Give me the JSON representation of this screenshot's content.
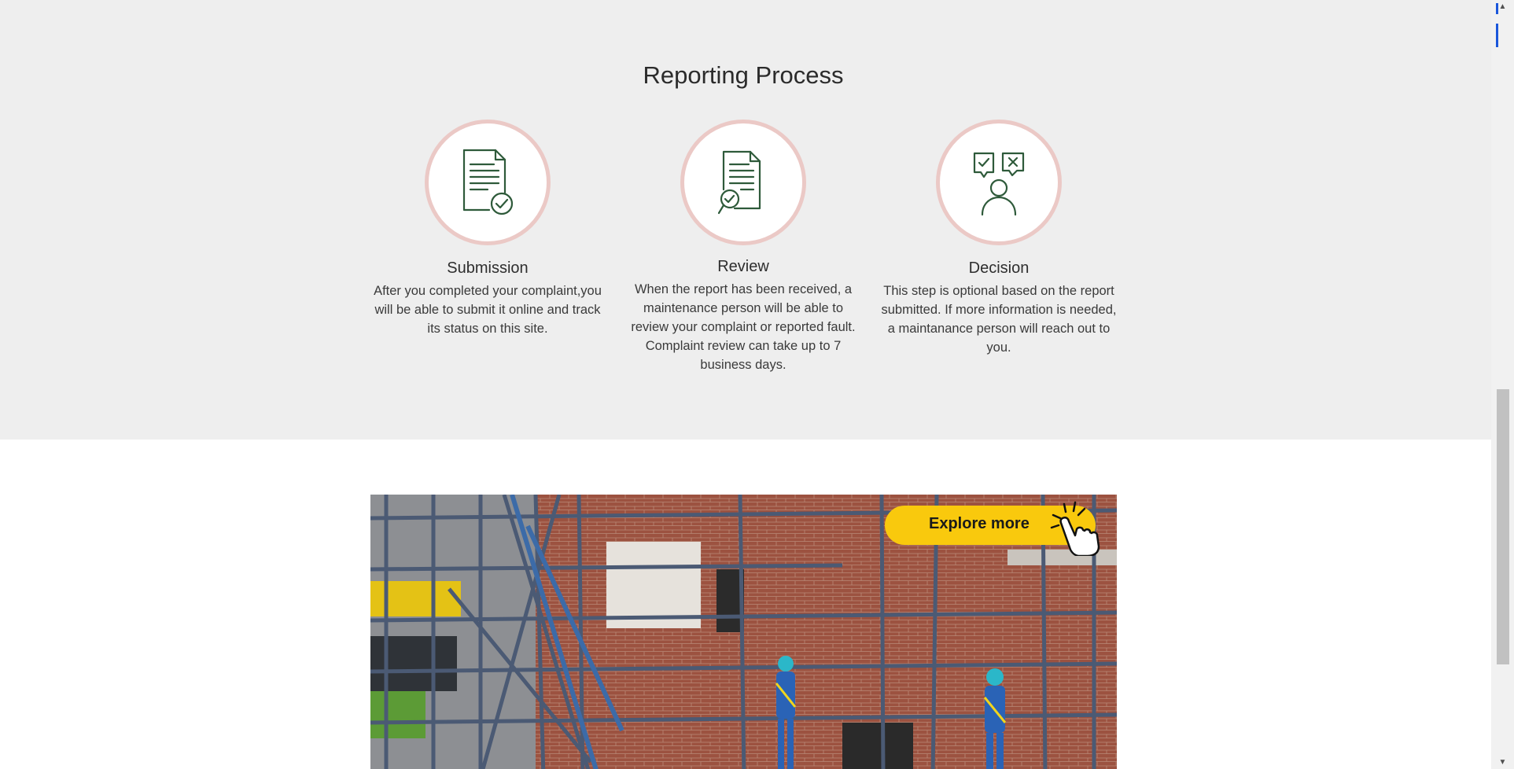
{
  "section": {
    "title": "Reporting Process"
  },
  "steps": [
    {
      "title": "Submission",
      "icon": "document-check-icon",
      "description": "After you completed your complaint,you will be able to submit it online and track its status on this site."
    },
    {
      "title": "Review",
      "icon": "document-magnifier-icon",
      "description": "When the report has been received, a maintenance person will be able to review your complaint or reported fault. Complaint review can take up to 7 business days."
    },
    {
      "title": "Decision",
      "icon": "person-decision-icon",
      "description": "This step is optional based on the report submitted. If more information is needed, a maintanance person will reach out to you."
    }
  ],
  "banner": {
    "button_label": "Explore more",
    "button_color": "#f9c90d",
    "icon": "pointing-hand-icon"
  },
  "colors": {
    "icon_green": "#2e5a3a",
    "circle_border": "#ebc9c6",
    "section_bg": "#eeeeee"
  }
}
